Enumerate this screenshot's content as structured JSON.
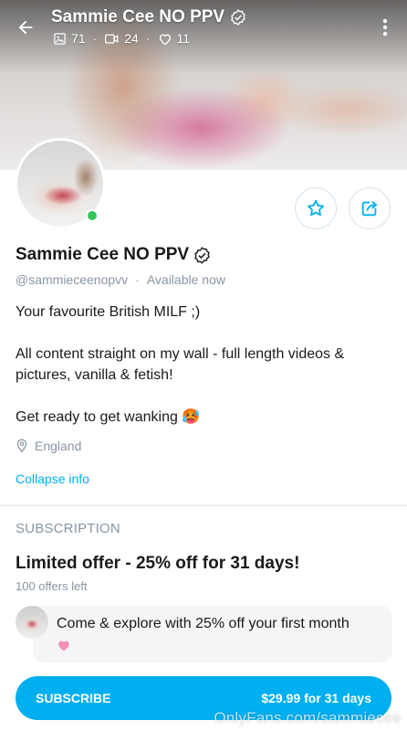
{
  "header": {
    "title": "Sammie Cee NO PPV",
    "stats": {
      "photos": "71",
      "videos": "24",
      "likes": "11"
    },
    "icons": {
      "back": "arrow-left-icon",
      "more": "kebab-menu-icon"
    }
  },
  "profile": {
    "name": "Sammie Cee NO PPV",
    "handle": "@sammieceenopvv",
    "separator": "·",
    "status": "Available now",
    "online": true,
    "bio": [
      "Your favourite British MILF ;)",
      "",
      "All content straight on my wall - full length videos & pictures, vanilla & fetish!",
      "",
      "Get ready to get wanking 🥵"
    ],
    "location": "England",
    "collapse_label": "Collapse info"
  },
  "subscription": {
    "section_label": "SUBSCRIPTION",
    "offer_title": "Limited offer - 25% off for 31 days!",
    "offers_left": "100 offers left",
    "message": "Come & explore with 25% off your first month",
    "button_label": "SUBSCRIBE",
    "button_price": "$29.99 for 31 days"
  },
  "watermark": "OnlyFans.com/sammiecee",
  "colors": {
    "accent": "#00aff0",
    "online": "#34c55a",
    "muted": "#8a96a3"
  }
}
